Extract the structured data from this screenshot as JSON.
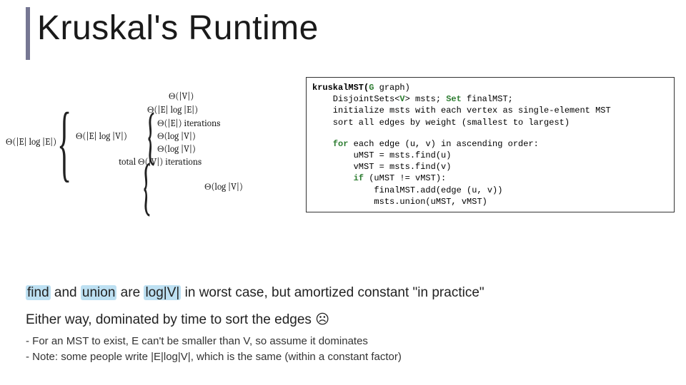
{
  "title": "Kruskal's Runtime",
  "complexity": {
    "left_sum": "Θ(|E| log |E|)",
    "inner": {
      "row1": "Θ(|V|)",
      "row2": "Θ(|E| log |E|)",
      "row3_left": "Θ(|E| log |V|)",
      "row3_right_a": "Θ(log |V|)",
      "row3_right_b": "Θ(log |V|)",
      "total_label": "total Θ(|V|) iterations",
      "row3_iter": "Θ(|E|) iterations",
      "row5": "Θ(log |V|)"
    }
  },
  "code": {
    "l1a": "kruskalMST(",
    "l1b": "G",
    "l1c": " graph)",
    "l2a": "    DisjointSets<",
    "l2b": "V",
    "l2c": "> msts; ",
    "l2d": "Set",
    "l2e": " finalMST;",
    "l3": "    initialize msts with each vertex as single-element MST",
    "l4": "    sort all edges by weight (smallest to largest)",
    "l5a": "    for",
    "l5b": " each edge (u, v) in ascending order:",
    "l6": "        uMST = msts.find(u)",
    "l7": "        vMST = msts.find(v)",
    "l8a": "        if",
    "l8b": " (uMST != vMST):",
    "l9": "            finalMST.add(edge (u, v))",
    "l10": "            msts.union(uMST, vMST)"
  },
  "body": {
    "line1_a": "find",
    "line1_b": " and ",
    "line1_c": "union",
    "line1_d": " are ",
    "line1_e": "log|V|",
    "line1_f": " in worst case, but amortized constant \"in practice\"",
    "line2": "Either way, dominated by time to sort the edges ☹",
    "sub1": "For an MST to exist, E can't be smaller than V, so assume it dominates",
    "sub2": "Note: some people write |E|log|V|, which is the same (within a constant factor)"
  }
}
